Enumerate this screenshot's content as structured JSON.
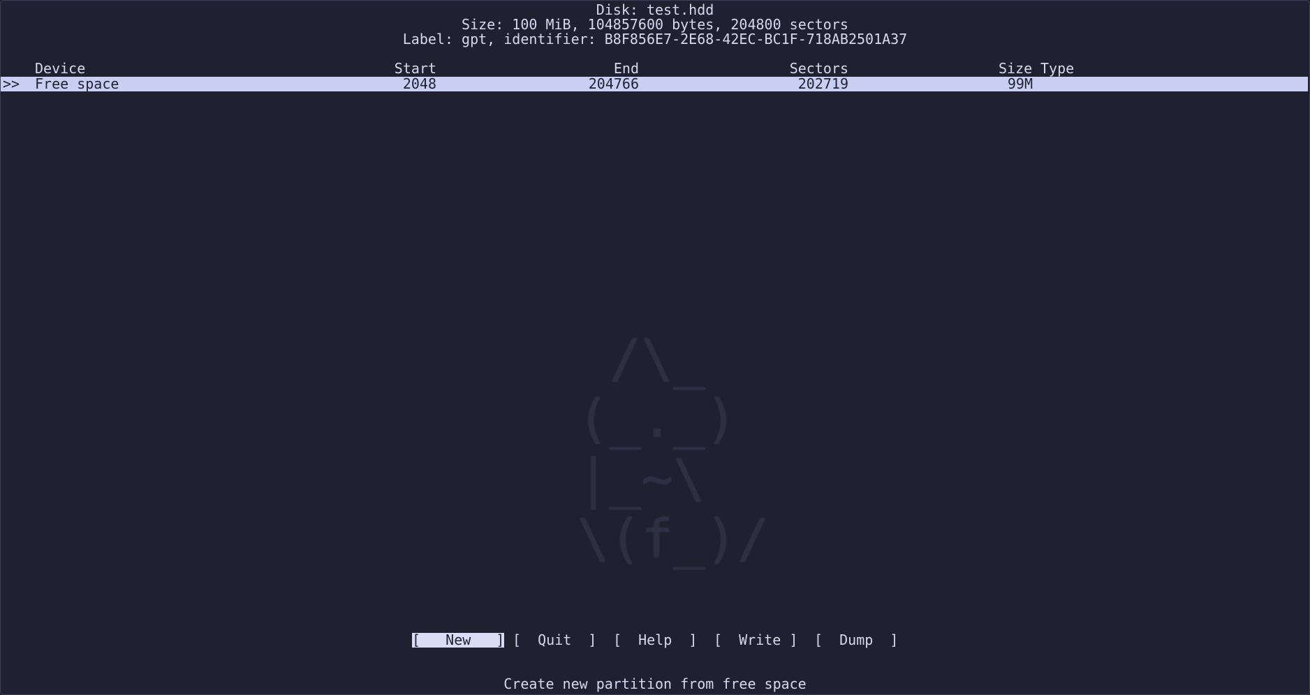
{
  "header": {
    "disk": "Disk: test.hdd",
    "size": "Size: 100 MiB, 104857600 bytes, 204800 sectors",
    "label": "Label: gpt, identifier: B8F856E7-2E68-42EC-BC1F-718AB2501A37"
  },
  "table": {
    "columns": {
      "device": "Device",
      "start": "Start",
      "end": "End",
      "sectors": "Sectors",
      "size": "Size",
      "type": "Type"
    },
    "rows": [
      {
        "marker": ">>",
        "device": "Free space",
        "start": "2048",
        "end": "204766",
        "sectors": "202719",
        "size": "99M",
        "type": ""
      }
    ]
  },
  "menu": {
    "new": "[   New   ]",
    "quit": "[  Quit  ]",
    "help": "[  Help  ]",
    "write": "[  Write ]",
    "dump": "[  Dump  ]"
  },
  "status": "Create new partition from free space",
  "watermark_art": "  /\\_\n (_._)\n |_~\\\n \\(f_)/"
}
